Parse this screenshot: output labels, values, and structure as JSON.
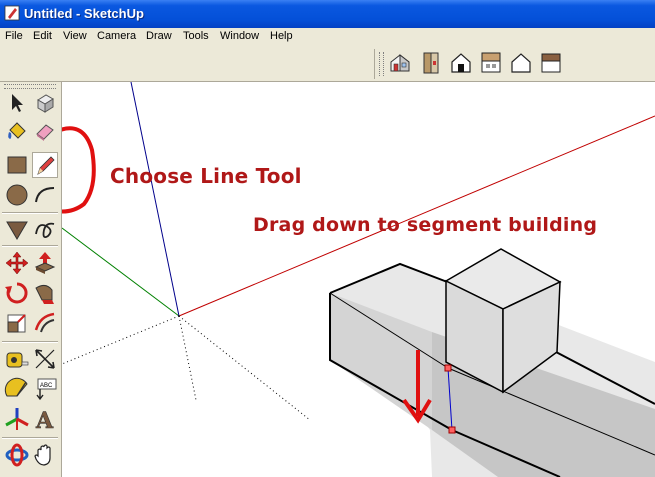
{
  "window": {
    "title": "Untitled - SketchUp"
  },
  "menu": {
    "items": [
      "File",
      "Edit",
      "View",
      "Camera",
      "Draw",
      "Tools",
      "Window",
      "Help"
    ]
  },
  "views_toolbar": {
    "buttons": [
      "iso-view-icon",
      "top-view-icon",
      "front-view-icon",
      "right-view-icon",
      "back-view-icon",
      "left-view-icon"
    ]
  },
  "tools": [
    "select-icon",
    "make-component-icon",
    "paint-bucket-icon",
    "eraser-icon",
    "rectangle-icon",
    "line-pencil-icon",
    "circle-icon",
    "arc-icon",
    "polygon-icon",
    "freehand-icon",
    "move-icon",
    "push-pull-icon",
    "rotate-icon",
    "follow-me-icon",
    "scale-icon",
    "offset-icon",
    "tape-measure-icon",
    "dimension-icon",
    "protractor-icon",
    "text-icon",
    "axes-icon",
    "3d-text-icon",
    "orbit-icon",
    "pan-icon"
  ],
  "annotations": {
    "choose_line_tool": "Choose Line Tool",
    "drag_down": "Drag down to segment building"
  },
  "colors": {
    "annotation": "#b01818",
    "red_axis": "#c00000",
    "green_axis": "#008000",
    "blue_axis": "#00008b",
    "face": "#e4e4e4",
    "titlebar": "#0450d8"
  }
}
